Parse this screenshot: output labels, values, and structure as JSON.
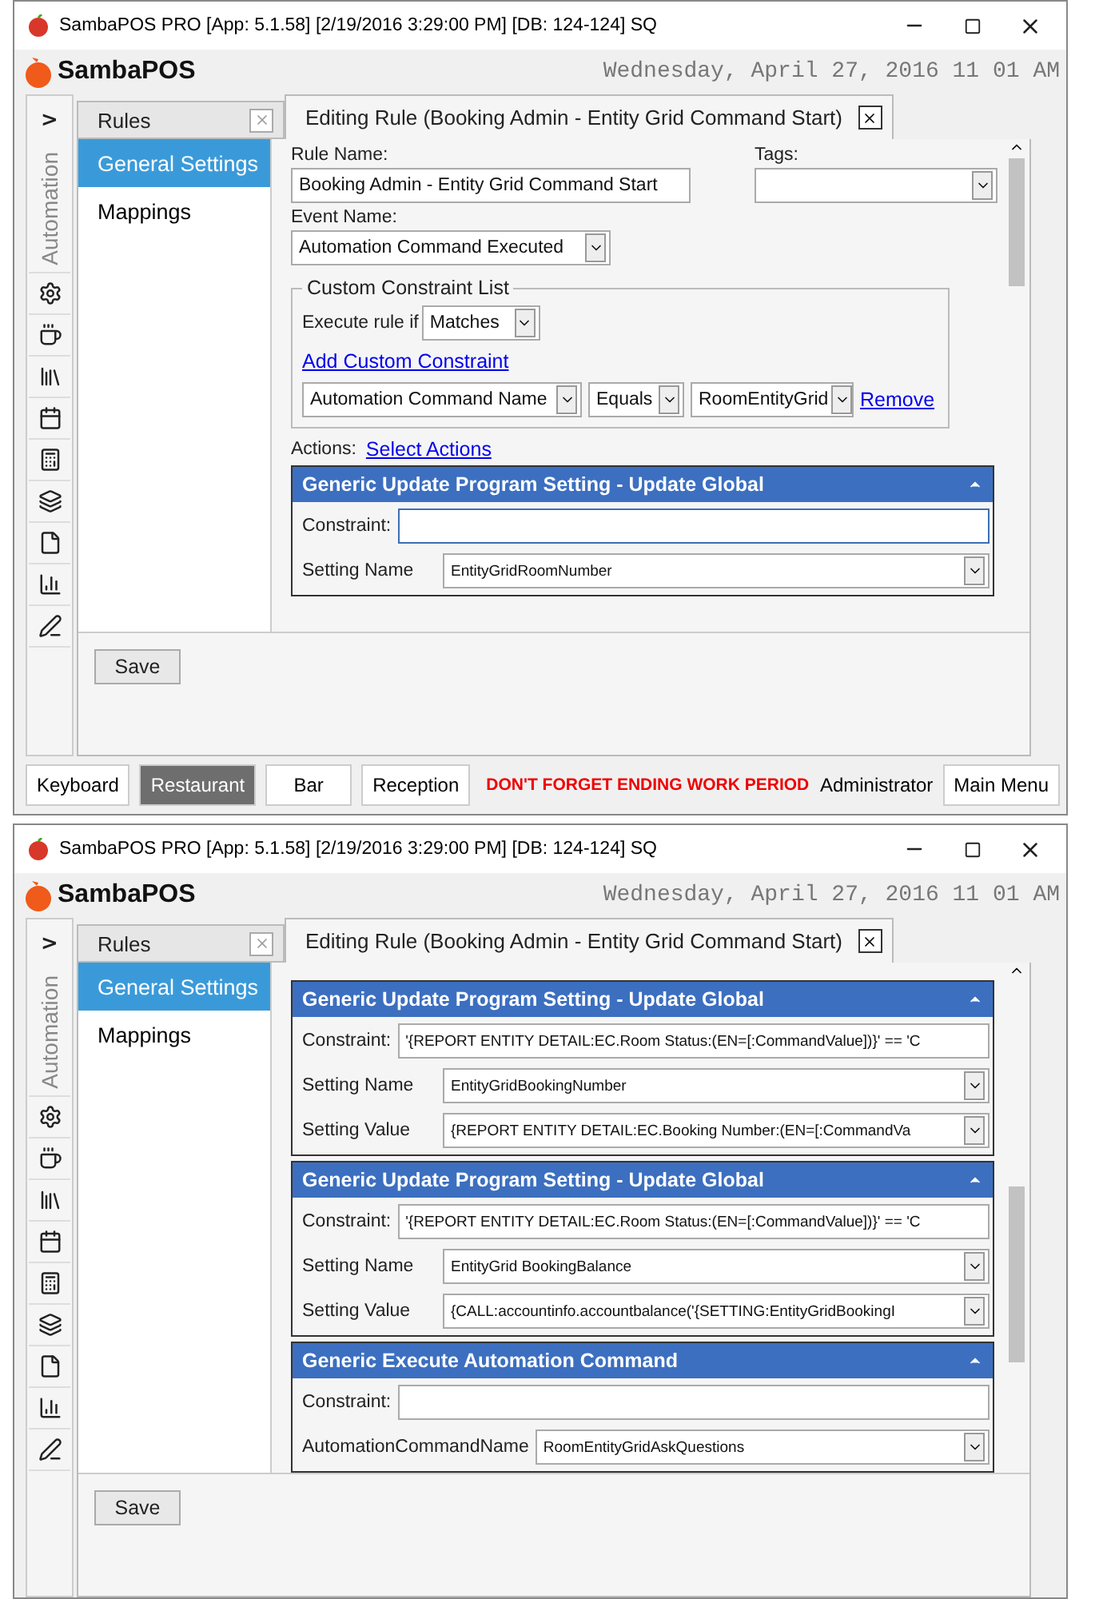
{
  "windows": [
    {
      "title": "SambaPOS PRO [App: 5.1.58] [2/19/2016 3:29:00 PM] [DB: 124-124] SQ",
      "brand": "SambaPOS",
      "clock": "Wednesday, April 27, 2016 11 01 AM",
      "sidebar": {
        "toggle": ">",
        "label": "Automation"
      },
      "tabs": [
        {
          "label": "Rules",
          "selected": false
        },
        {
          "label": "Editing Rule (Booking Admin - Entity Grid Command Start)",
          "selected": true
        }
      ],
      "nav": [
        {
          "label": "General Settings",
          "selected": true
        },
        {
          "label": "Mappings",
          "selected": false
        }
      ],
      "form": {
        "rule_name_label": "Rule Name:",
        "rule_name": "Booking Admin - Entity Grid Command Start",
        "tags_label": "Tags:",
        "event_name_label": "Event Name:",
        "event_name": "Automation Command Executed",
        "constraints": {
          "title": "Custom Constraint List",
          "execute_label": "Execute rule if",
          "match": "Matches",
          "add_link": "Add Custom Constraint",
          "rows": [
            {
              "name": "Automation Command Name",
              "operator": "Equals",
              "value": "RoomEntityGrid",
              "remove": "Remove"
            }
          ]
        },
        "actions_label": "Actions:",
        "select_actions": "Select Actions"
      },
      "actions": [
        {
          "title": "Generic Update Program Setting - Update Global",
          "fields": [
            {
              "kind": "text",
              "label": "Constraint:",
              "focused": true
            },
            {
              "kind": "select",
              "label": "Setting Name",
              "value": "EntityGridRoomNumber"
            }
          ]
        }
      ],
      "save": "Save",
      "bottom_bar": {
        "buttons": [
          {
            "label": "Keyboard",
            "selected": false
          },
          {
            "label": "Restaurant",
            "selected": true
          },
          {
            "label": "Bar",
            "selected": false
          },
          {
            "label": "Reception",
            "selected": false
          }
        ],
        "warning": "DON'T FORGET ENDING WORK PERIOD",
        "user": "Administrator",
        "main_menu": "Main Menu"
      }
    },
    {
      "title": "SambaPOS PRO [App: 5.1.58] [2/19/2016 3:29:00 PM] [DB: 124-124] SQ",
      "brand": "SambaPOS",
      "clock": "Wednesday, April 27, 2016 11 01 AM",
      "sidebar": {
        "toggle": ">",
        "label": "Automation"
      },
      "tabs": [
        {
          "label": "Rules",
          "selected": false
        },
        {
          "label": "Editing Rule (Booking Admin - Entity Grid Command Start)",
          "selected": true
        }
      ],
      "nav": [
        {
          "label": "General Settings",
          "selected": true
        },
        {
          "label": "Mappings",
          "selected": false
        }
      ],
      "actions": [
        {
          "title": "Generic Update Program Setting - Update Global",
          "fields": [
            {
              "kind": "text",
              "label": "Constraint:",
              "value": "'{REPORT ENTITY DETAIL:EC.Room Status:(EN=[:CommandValue])}' == 'C",
              "focused": false
            },
            {
              "kind": "select",
              "label": "Setting Name",
              "value": "EntityGridBookingNumber"
            },
            {
              "kind": "select",
              "label": "Setting Value",
              "value": "{REPORT ENTITY DETAIL:EC.Booking Number:(EN=[:CommandVa"
            }
          ]
        },
        {
          "title": "Generic Update Program Setting - Update Global",
          "fields": [
            {
              "kind": "text",
              "label": "Constraint:",
              "value": "'{REPORT ENTITY DETAIL:EC.Room Status:(EN=[:CommandValue])}' == 'C",
              "focused": false
            },
            {
              "kind": "select",
              "label": "Setting Name",
              "value": "EntityGrid BookingBalance"
            },
            {
              "kind": "select",
              "label": "Setting Value",
              "value": "{CALL:accountinfo.accountbalance('{SETTING:EntityGridBookingI"
            }
          ]
        },
        {
          "title": "Generic Execute Automation Command",
          "fields": [
            {
              "kind": "text",
              "label": "Constraint:",
              "focused": false
            },
            {
              "kind": "select",
              "label": "AutomationCommandName",
              "value": "RoomEntityGridAskQuestions"
            }
          ]
        }
      ],
      "save": "Save"
    }
  ]
}
